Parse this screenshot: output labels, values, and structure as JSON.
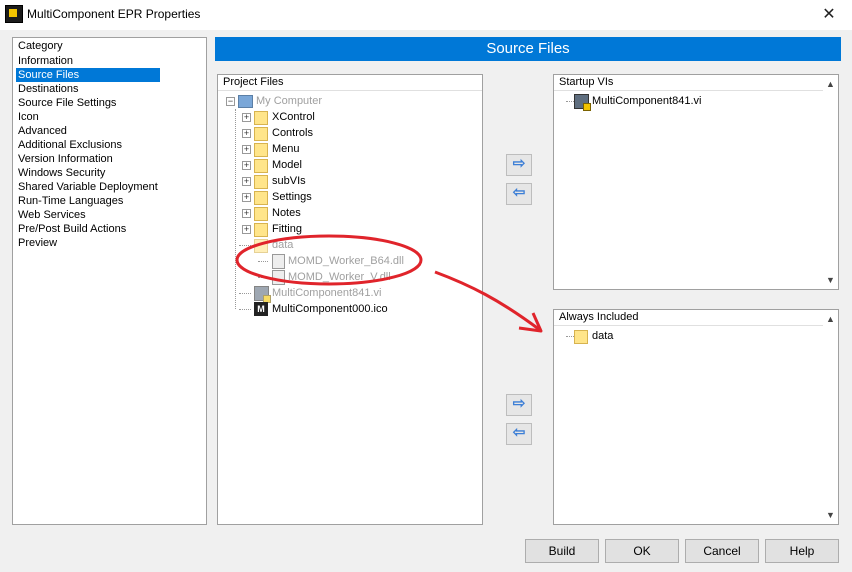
{
  "window": {
    "title": "MultiComponent EPR Properties",
    "close_glyph": "✕"
  },
  "category": {
    "header": "Category",
    "items": [
      "Information",
      "Source Files",
      "Destinations",
      "Source File Settings",
      "Icon",
      "Advanced",
      "Additional Exclusions",
      "Version Information",
      "Windows Security",
      "Shared Variable Deployment",
      "Run-Time Languages",
      "Web Services",
      "Pre/Post Build Actions",
      "Preview"
    ],
    "selected": "Source Files"
  },
  "banner": {
    "title": "Source Files"
  },
  "project_files": {
    "header": "Project Files",
    "root": "My Computer",
    "folders": [
      "XControl",
      "Controls",
      "Menu",
      "Model",
      "subVIs",
      "Settings",
      "Notes",
      "Fitting"
    ],
    "data_folder": "data",
    "data_children": [
      "MOMD_Worker_B64.dll",
      "MOMD_Worker_V.dll"
    ],
    "vi_file": "MultiComponent841.vi",
    "ico_file": "MultiComponent000.ico",
    "ico_glyph": "M"
  },
  "startup_vis": {
    "header": "Startup VIs",
    "items": [
      "MultiComponent841.vi"
    ]
  },
  "always_included": {
    "header": "Always Included",
    "items": [
      "data"
    ]
  },
  "arrows": {
    "add": "⇨",
    "remove": "⇦"
  },
  "scroll": {
    "up": "▲",
    "down": "▼"
  },
  "buttons": {
    "build": "Build",
    "ok": "OK",
    "cancel": "Cancel",
    "help": "Help"
  },
  "annotation_color": "#e0242b"
}
